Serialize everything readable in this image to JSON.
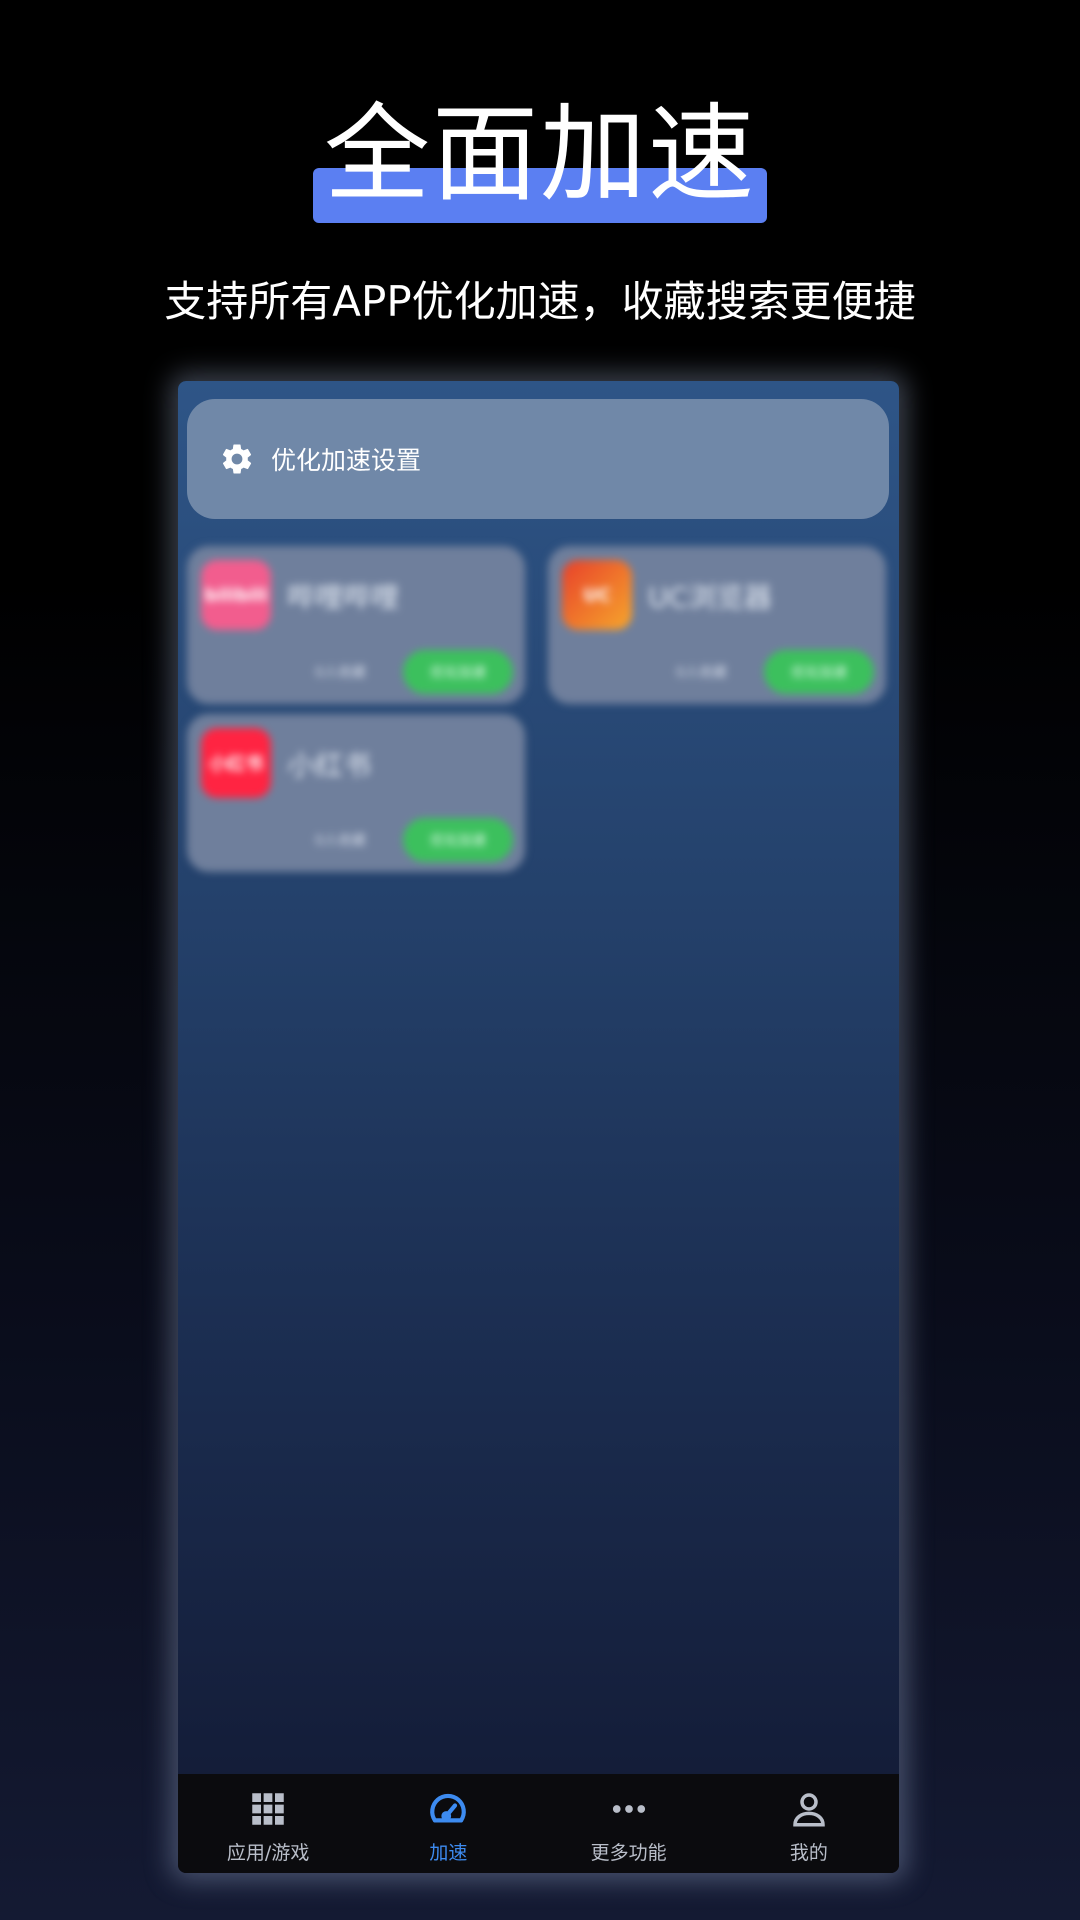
{
  "promo": {
    "headline": "全面加速",
    "subheadline": "支持所有APP优化加速，收藏搜索更便捷"
  },
  "settings": {
    "label": "优化加速设置",
    "icon": "gear-icon"
  },
  "apps": [
    {
      "name": "哔哩哔哩",
      "icon_text": "bilibili",
      "icon_color": "#f25d8e",
      "count": "0人收藏",
      "button": "优化加速"
    },
    {
      "name": "UC浏览器",
      "icon_text": "UC",
      "icon_color": "#f0782a",
      "count": "0人收藏",
      "button": "优化加速"
    },
    {
      "name": "小红书",
      "icon_text": "小红书",
      "icon_color": "#ff2442",
      "count": "0人收藏",
      "button": "优化加速"
    }
  ],
  "tabs": [
    {
      "label": "应用/游戏",
      "icon": "grid-icon",
      "active": false
    },
    {
      "label": "加速",
      "icon": "speedometer-icon",
      "active": true
    },
    {
      "label": "更多功能",
      "icon": "more-icon",
      "active": false
    },
    {
      "label": "我的",
      "icon": "user-icon",
      "active": false
    }
  ],
  "colors": {
    "accent": "#3d8bf0",
    "headline_bar": "#5b7ff2",
    "accelerate_button": "#3cc05d"
  }
}
